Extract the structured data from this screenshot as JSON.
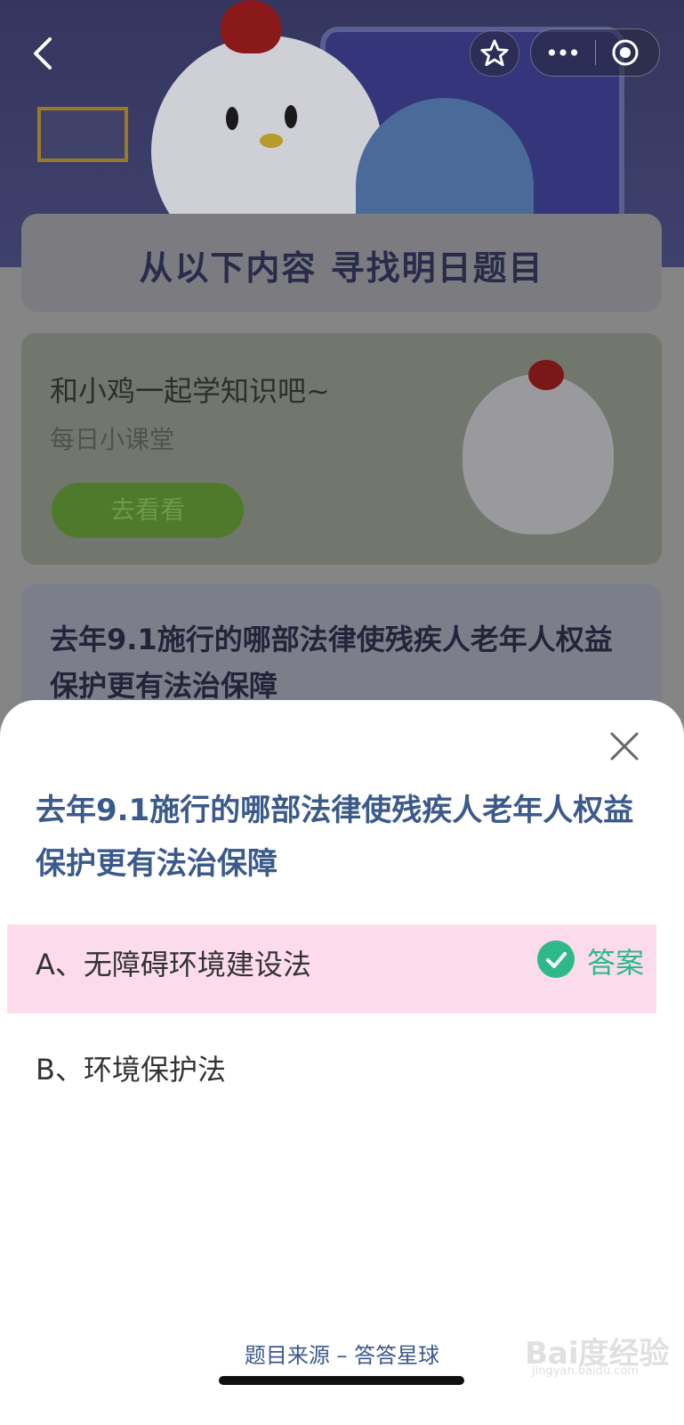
{
  "header": {
    "back_icon": "chevron-left-icon",
    "star_icon": "star-icon",
    "more_icon": "ellipsis-icon",
    "target_icon": "record-icon"
  },
  "background": {
    "panel_heading": "从以下内容  寻找明日题目",
    "learn_card": {
      "title": "和小鸡一起学知识吧~",
      "subtitle": "每日小课堂",
      "button": "去看看"
    },
    "question_card": {
      "text": "去年9.1施行的哪部法律使残疾人老年人权益保护更有法治保障"
    }
  },
  "sheet": {
    "question": "去年9.1施行的哪部法律使残疾人老年人权益保护更有法治保障",
    "options": [
      {
        "label": "A、无障碍环境建设法",
        "is_answer": true,
        "answer_tag": "答案"
      },
      {
        "label": "B、环境保护法",
        "is_answer": false
      }
    ],
    "source": "题目来源 – 答答星球"
  },
  "watermark": {
    "text": "Bai度经验",
    "url": "jingyan.baidu.com"
  },
  "colors": {
    "accent": "#3b5a8c",
    "correct": "#2fb98a",
    "highlight": "#fcdcec"
  }
}
